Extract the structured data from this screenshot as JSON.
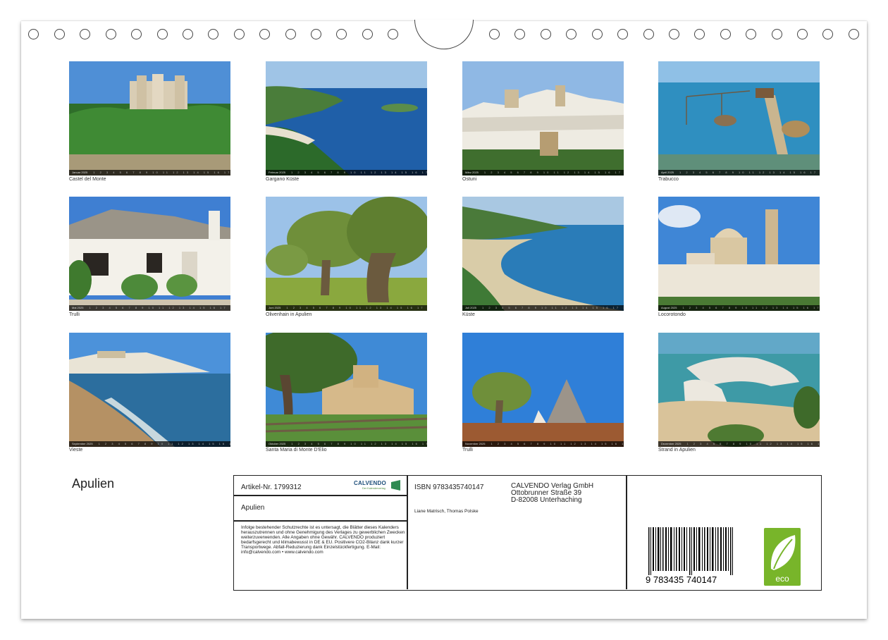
{
  "photos": [
    {
      "caption": "Castel del Monte",
      "month": "Januar 2025"
    },
    {
      "caption": "Gargano Küste",
      "month": "Februar 2025"
    },
    {
      "caption": "Ostuni",
      "month": "März 2025"
    },
    {
      "caption": "Trabucco",
      "month": "April 2025"
    },
    {
      "caption": "Trulli",
      "month": "Mai 2025"
    },
    {
      "caption": "Olivenhain in Apulien",
      "month": "Juni 2025"
    },
    {
      "caption": "Küste",
      "month": "Juli 2025"
    },
    {
      "caption": "Locorotondo",
      "month": "August 2025"
    },
    {
      "caption": "Vieste",
      "month": "September 2025"
    },
    {
      "caption": "Santa Maria di Monte D'Elio",
      "month": "Oktober 2025"
    },
    {
      "caption": "Trulli",
      "month": "November 2025"
    },
    {
      "caption": "Strand in Apulien",
      "month": "Dezember 2025"
    }
  ],
  "title": "Apulien",
  "info": {
    "article": "Artikel-Nr. 1799312",
    "product_title": "Apulien",
    "legal": "Infolge bestehender Schutzrechte ist es untersagt, die Blätter dieses Kalenders herauszutrennen und ohne Genehmigung des Verlages zu gewerblichen Zwecken weiterzuverwenden. Alle Angaben ohne Gewähr. CALVENDO produziert bedarfsgerecht und klimabewusst in DE & EU. Positivere CO2-Bilanz dank kurzer Transportwege. Abfall-Reduzierung dank Einzelstückfertigung. E-Mail: info@calvendo.com • www.calvendo.com",
    "isbn": "ISBN 9783435740147",
    "authors": "Liane Matrisch, Thomas Polske",
    "publisher_name": "CALVENDO Verlag GmbH",
    "publisher_street": "Ottobrunner Straße 39",
    "publisher_city": "D-82008 Unterhaching",
    "barcode_number": "9 783435 740147",
    "logo_text": "CALVENDO",
    "logo_sub": "Der Kalenderverlag",
    "eco_label": "eco"
  }
}
